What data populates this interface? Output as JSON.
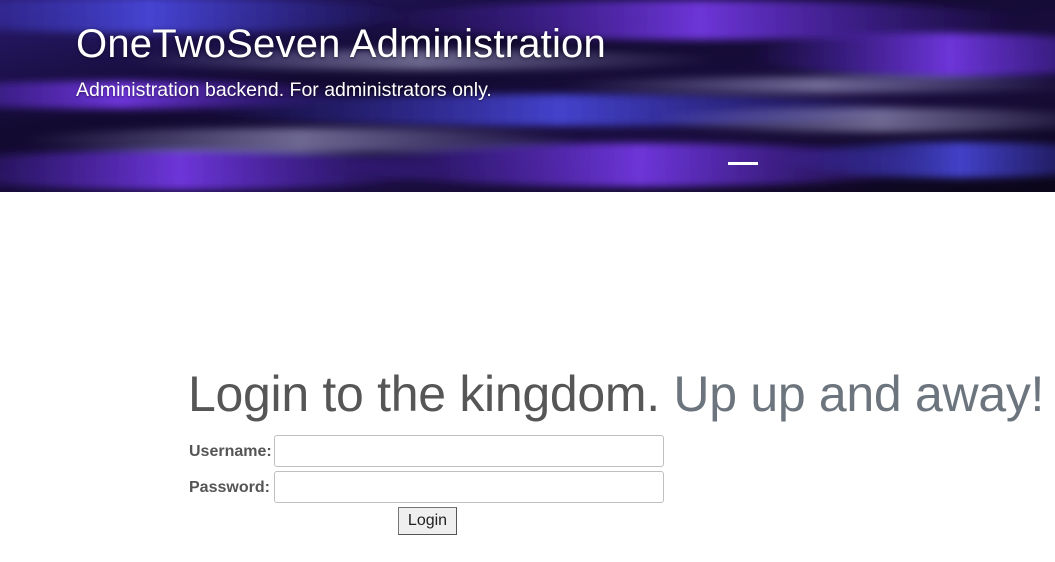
{
  "header": {
    "title": "OneTwoSeven Administration",
    "subtitle": "Administration backend. For administrators only."
  },
  "login": {
    "heading_main": "Login to the kingdom.",
    "heading_muted": "Up up and away!",
    "username_label": "Username:",
    "password_label": "Password:",
    "username_value": "",
    "password_value": "",
    "button_label": "Login"
  },
  "colors": {
    "hero_background": "#140a2e",
    "hero_accent": "#7b2cf0",
    "heading_text": "#565656",
    "heading_muted": "#6c757d",
    "label_text": "#555555"
  },
  "icons": {
    "menu_toggle": "menu-bar-icon"
  }
}
